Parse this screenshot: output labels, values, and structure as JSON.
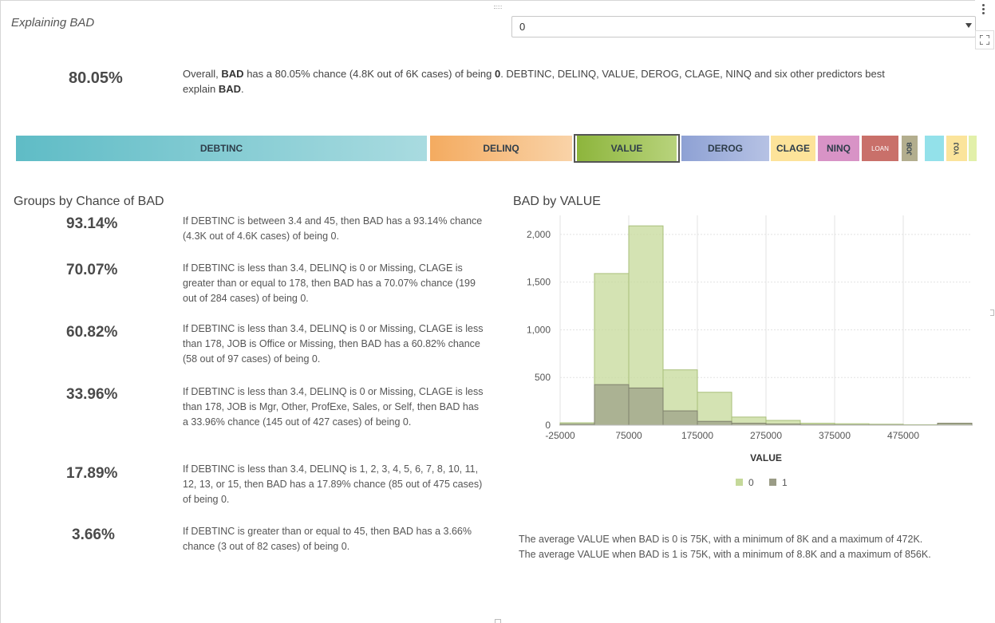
{
  "header": {
    "title": "Explaining BAD",
    "select_value": "0"
  },
  "overall": {
    "percent": "80.05%",
    "text_parts": [
      "Overall, ",
      "BAD",
      " has a 80.05% chance (4.8K out of 6K cases) of being ",
      "0",
      ". DEBTINC, DELINQ, VALUE, DEROG, CLAGE, NINQ and six other predictors best explain ",
      "BAD",
      "."
    ]
  },
  "predictors": [
    {
      "label": "DEBTINC",
      "from": "#5fbcc6",
      "to": "#a9dbe0"
    },
    {
      "label": "DELINQ",
      "from": "#f4ab60",
      "to": "#f9d3a8"
    },
    {
      "label": "VALUE",
      "from": "#8db53c",
      "to": "#b8d37c",
      "selected": true
    },
    {
      "label": "DEROG",
      "from": "#8ea1d4",
      "to": "#b6c2e4"
    },
    {
      "label": "CLAGE",
      "from": "#fde39a",
      "to": "#fde39a"
    },
    {
      "label": "NINQ",
      "from": "#d893c6",
      "to": "#d893c6"
    },
    {
      "label": "LOAN",
      "from": "#c9706a",
      "to": "#c9706a"
    },
    {
      "label": "JOB",
      "from": "#b3ae8e",
      "to": "#b3ae8e"
    },
    {
      "label": "",
      "from": "#93e1ea",
      "to": "#93e1ea"
    },
    {
      "label": "YOJ",
      "from": "#fbe49b",
      "to": "#fbe49b"
    },
    {
      "label": "",
      "from": "#e2f0a9",
      "to": "#e2f0a9"
    }
  ],
  "groups": {
    "title": "Groups by Chance of BAD",
    "items": [
      {
        "percent": "93.14%",
        "text": "If DEBTINC is between 3.4 and 45, then BAD has a 93.14% chance (4.3K out of 4.6K cases) of being 0."
      },
      {
        "percent": "70.07%",
        "text": "If DEBTINC is less than 3.4, DELINQ is 0 or Missing, CLAGE is greater than or equal to 178, then BAD has a 70.07% chance (199 out of 284 cases) of being 0."
      },
      {
        "percent": "60.82%",
        "text": "If DEBTINC is less than 3.4, DELINQ is 0 or Missing, CLAGE is less than 178, JOB is Office or Missing, then BAD has a 60.82% chance (58 out of 97 cases) of being 0."
      },
      {
        "percent": "33.96%",
        "text": "If DEBTINC is less than 3.4, DELINQ is 0 or Missing, CLAGE is less than 178, JOB is Mgr, Other, ProfExe, Sales, or Self, then BAD has a 33.96% chance (145 out of 427 cases) of being 0."
      },
      {
        "percent": "17.89%",
        "text": "If DEBTINC is less than 3.4, DELINQ is 1, 2, 3, 4, 5, 6, 7, 8, 10, 11, 12, 13, or 15, then BAD has a 17.89% chance (85 out of 475 cases) of being 0."
      },
      {
        "percent": "3.66%",
        "text": "If DEBTINC is greater than or equal to 45, then BAD has a 3.66% chance (3 out of 82 cases) of being 0."
      }
    ]
  },
  "chart_data": {
    "type": "bar",
    "title": "BAD by VALUE",
    "xlabel": "VALUE",
    "ylabel": "",
    "xlim": [
      -25000,
      575000
    ],
    "ylim": [
      0,
      2200
    ],
    "x_ticks": [
      "-25000",
      "75000",
      "175000",
      "275000",
      "375000",
      "475000"
    ],
    "x_tick_values": [
      -25000,
      75000,
      175000,
      275000,
      375000,
      475000
    ],
    "y_ticks": [
      "0",
      "500",
      "1,000",
      "1,500",
      "2,000"
    ],
    "y_tick_values": [
      0,
      500,
      1000,
      1500,
      2000
    ],
    "bin_edges": [
      -25000,
      25000,
      75000,
      125000,
      175000,
      225000,
      275000,
      325000,
      375000,
      425000,
      475000,
      525000,
      575000
    ],
    "series": [
      {
        "name": "0",
        "color": "#c5d99a",
        "values": [
          25,
          1590,
          2090,
          580,
          345,
          85,
          50,
          20,
          15,
          10,
          5,
          20
        ]
      },
      {
        "name": "1",
        "color": "#9a9c86",
        "values": [
          10,
          425,
          390,
          150,
          40,
          20,
          12,
          5,
          3,
          2,
          0,
          20
        ]
      }
    ],
    "legend": "bottom-center",
    "grid": true
  },
  "summary": {
    "line1": "The average VALUE when BAD is 0 is 75K, with a minimum of 8K and a maximum of 472K.",
    "line2": "The average VALUE when BAD is 1 is 75K, with a minimum of 8.8K and a maximum of 856K."
  },
  "icons": {
    "menu": "kebab-menu-icon",
    "maximize": "maximize-icon",
    "dropdown": "chevron-down-icon"
  }
}
